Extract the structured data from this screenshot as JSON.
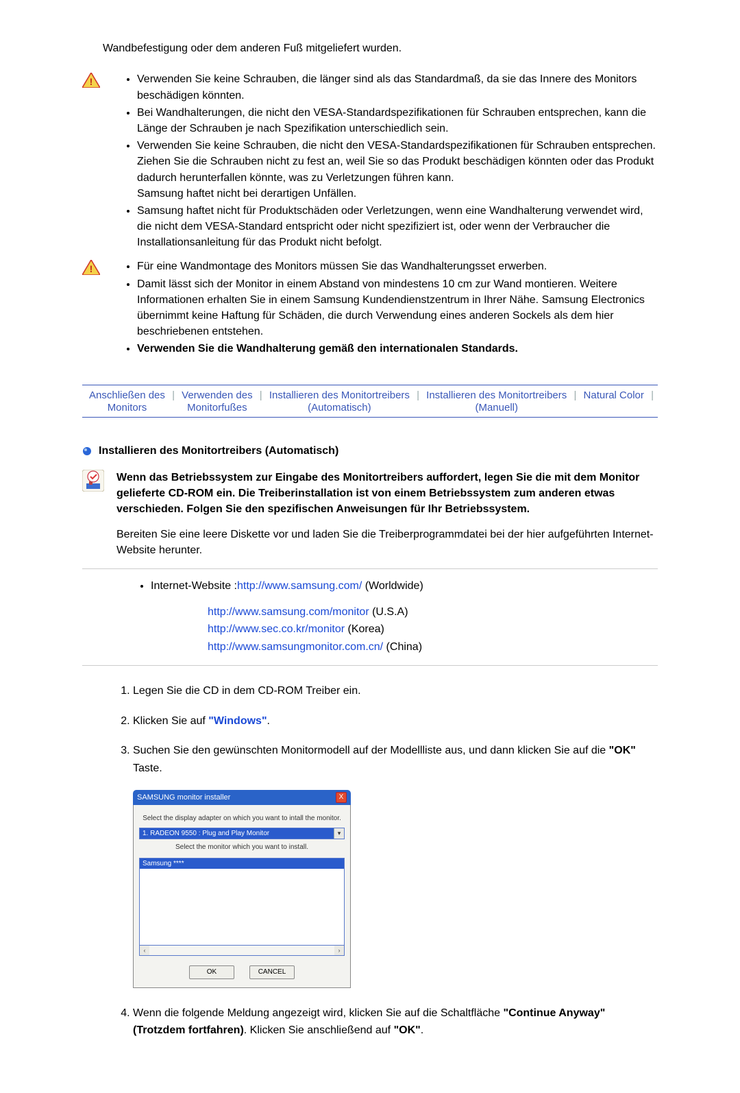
{
  "lead_line": "Wandbefestigung oder dem anderen Fuß mitgeliefert wurden.",
  "warnings1": {
    "b1": "Verwenden Sie keine Schrauben, die länger sind als das Standardmaß, da sie das Innere des Monitors beschädigen könnten.",
    "b2": "Bei Wandhalterungen, die nicht den VESA-Standardspezifikationen für Schrauben entsprechen, kann die Länge der Schrauben je nach Spezifikation unterschiedlich sein.",
    "b3_main": "Verwenden Sie keine Schrauben, die nicht den VESA-Standardspezifikationen für Schrauben entsprechen.",
    "b3_sub1": "Ziehen Sie die Schrauben nicht zu fest an, weil Sie so das Produkt beschädigen könnten oder das Produkt dadurch herunterfallen könnte, was zu Verletzungen führen kann.",
    "b3_sub2": "Samsung haftet nicht bei derartigen Unfällen.",
    "b4": "Samsung haftet nicht für Produktschäden oder Verletzungen, wenn eine Wandhalterung verwendet wird, die nicht dem VESA-Standard entspricht oder nicht spezifiziert ist, oder wenn der Verbraucher die Installationsanleitung für das Produkt nicht befolgt."
  },
  "warnings2": {
    "b1": "Für eine Wandmontage des Monitors müssen Sie das Wandhalterungsset erwerben.",
    "b2": "Damit lässt sich der Monitor in einem Abstand von mindestens 10 cm zur Wand montieren. Weitere Informationen erhalten Sie in einem Samsung Kundendienstzentrum in Ihrer Nähe. Samsung Electronics übernimmt keine Haftung für Schäden, die durch Verwendung eines anderen Sockels als dem hier beschriebenen entstehen.",
    "b3_bold": "Verwenden Sie die Wandhalterung gemäß den internationalen Standards."
  },
  "tabs": {
    "t1a": "Anschließen des",
    "t1b": "Monitors",
    "t2a": "Verwenden des",
    "t2b": "Monitorfußes",
    "t3a": "Installieren des Monitortreibers",
    "t3b": "(Automatisch)",
    "t4a": "Installieren des Monitortreibers",
    "t4b": "(Manuell)",
    "t5a": "Natural Color"
  },
  "section_title": "Installieren des Monitortreibers (Automatisch)",
  "info_paragraph": "Wenn das Betriebssystem zur Eingabe des Monitortreibers auffordert, legen Sie die mit dem Monitor gelieferte CD-ROM ein. Die Treiberinstallation ist von einem Betriebssystem zum anderen etwas verschieden. Folgen Sie den spezifischen Anweisungen für Ihr Betriebssystem.",
  "prepare_text": "Bereiten Sie eine leere Diskette vor und laden Sie die Treiberprogrammdatei bei der hier aufgeführten Internet-Website herunter.",
  "website_label": "Internet-Website :",
  "links": {
    "u1": "http://www.samsung.com/",
    "r1": " (Worldwide)",
    "u2": "http://www.samsung.com/monitor",
    "r2": " (U.S.A)",
    "u3": "http://www.sec.co.kr/monitor",
    "r3": " (Korea)",
    "u4": "http://www.samsungmonitor.com.cn/",
    "r4": " (China)"
  },
  "steps": {
    "s1": "Legen Sie die CD in dem CD-ROM Treiber ein.",
    "s2_a": "Klicken Sie auf ",
    "s2_link": "\"Windows\"",
    "s2_b": ".",
    "s3_a": "Suchen Sie den gewünschten Monitormodell auf der Modellliste aus, und dann klicken Sie auf die ",
    "s3_bold": "\"OK\"",
    "s3_b": " Taste.",
    "s4_a": "Wenn die folgende Meldung angezeigt wird, klicken Sie auf die Schaltfläche ",
    "s4_bold1": "\"Continue Anyway\" (Trotzdem fortfahren)",
    "s4_b": ". Klicken Sie anschließend auf ",
    "s4_bold2": "\"OK\"",
    "s4_c": "."
  },
  "installer": {
    "title": "SAMSUNG monitor installer",
    "caption1": "Select the display adapter on which you want to intall the monitor.",
    "adapter": "1. RADEON 9550 : Plug and Play Monitor",
    "caption2": "Select the monitor which you want to install.",
    "list_item": "Samsung ****",
    "ok": "OK",
    "cancel": "CANCEL",
    "close_x": "X"
  }
}
